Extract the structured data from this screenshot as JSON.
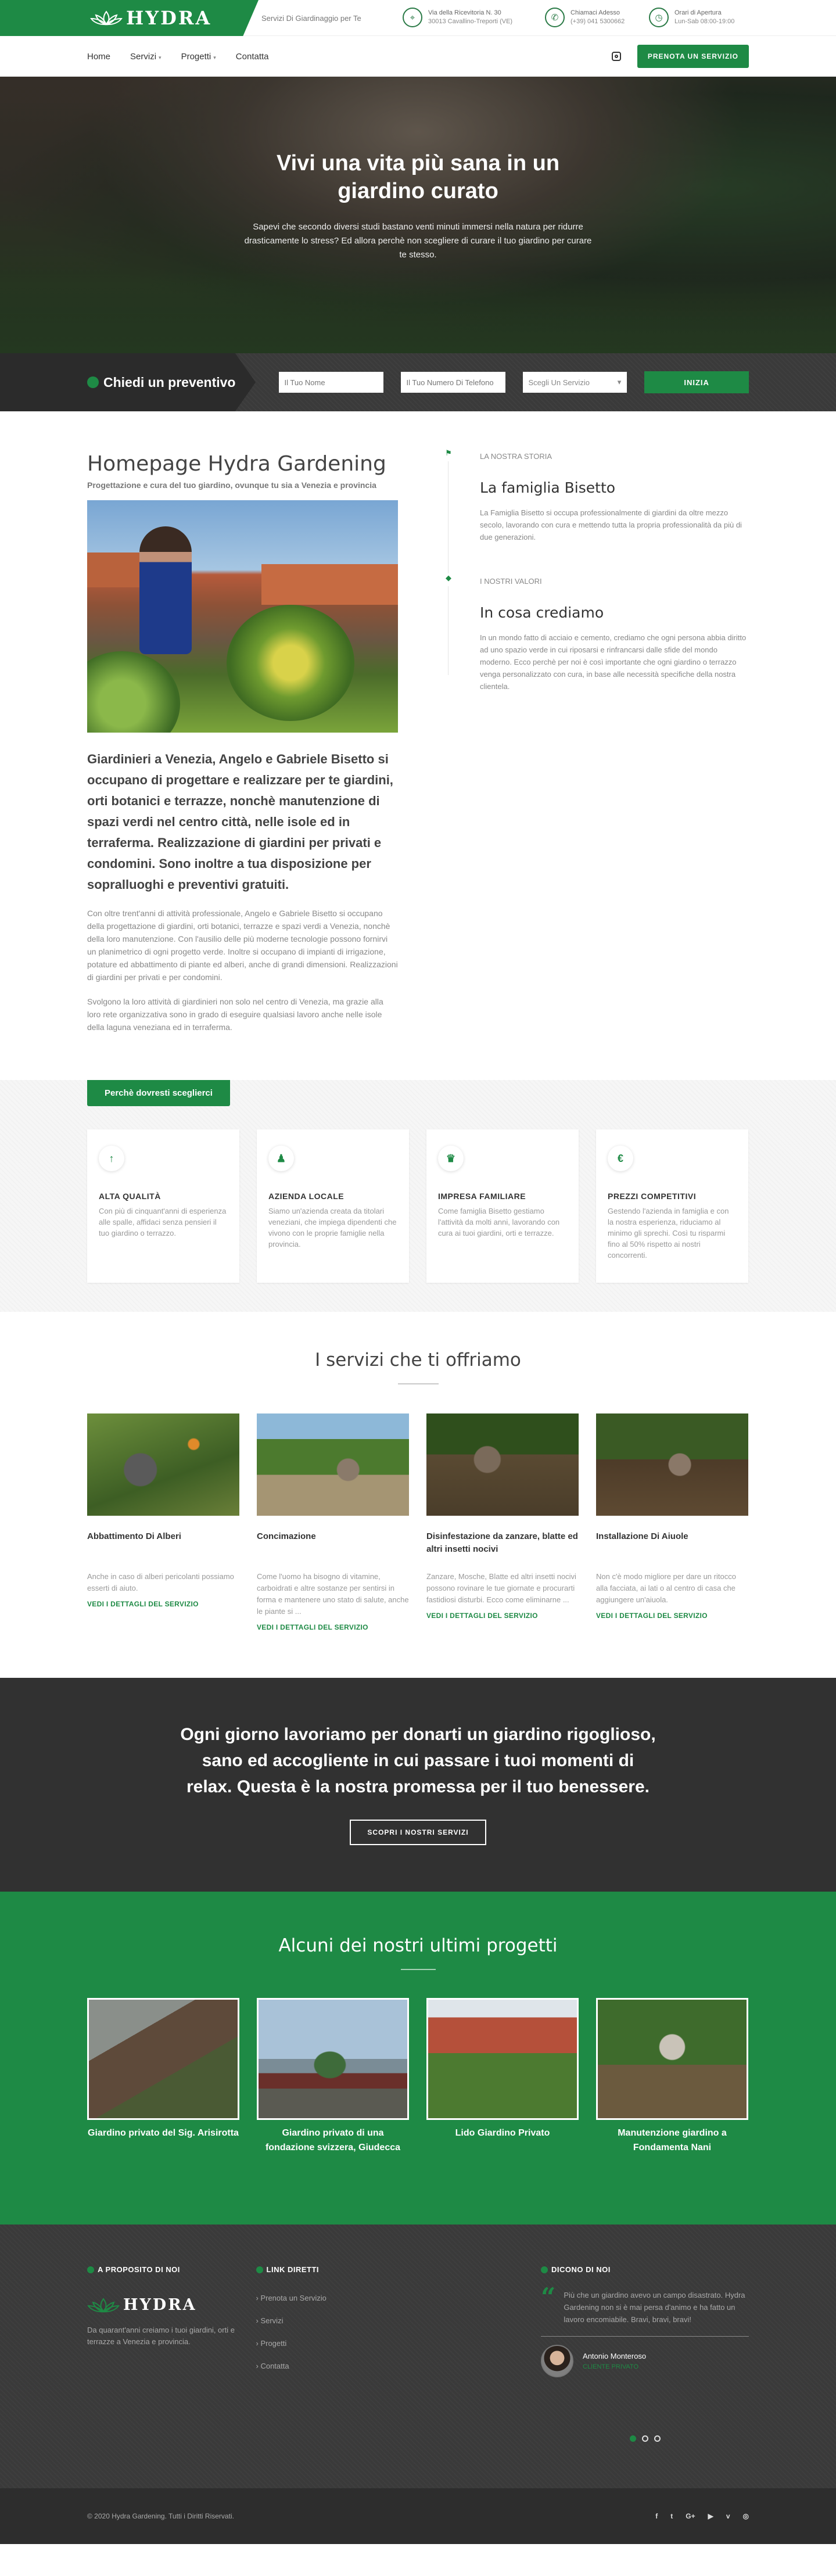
{
  "brand": {
    "name": "HYDRA",
    "tagline": "Servizi Di Giardinaggio per Te",
    "green": "#1e8a45",
    "dark": "#313131"
  },
  "contacts": [
    {
      "icon": "map-pin-icon",
      "title": "Via della Ricevitoria N. 30",
      "text": "30013 Cavallino-Treporti (VE)"
    },
    {
      "icon": "phone-icon",
      "title": "Chiamaci Adesso",
      "text": "(+39) 041 5300662"
    },
    {
      "icon": "clock-icon",
      "title": "Orari di Apertura",
      "text": "Lun-Sab 08:00-19:00"
    }
  ],
  "nav": {
    "items": [
      {
        "label": "Home",
        "caret": ""
      },
      {
        "label": "Servizi",
        "caret": "▾"
      },
      {
        "label": "Progetti",
        "caret": "▾"
      },
      {
        "label": "Contatta",
        "caret": ""
      }
    ],
    "cta": "PRENOTA UN SERVIZIO"
  },
  "hero": {
    "title": "Vivi una vita più sana in un giardino curato",
    "text": "Sapevi che secondo diversi studi bastano venti minuti immersi nella natura per ridurre drasticamente lo stress? Ed allora perchè non scegliere di curare il tuo giardino per curare te stesso."
  },
  "quote": {
    "title": "Chiedi un preventivo",
    "name_placeholder": "Il Tuo Nome",
    "phone_placeholder": "Il Tuo Numero Di Telefono",
    "select_value": "Scegli Un Servizio",
    "submit": "INIZIA"
  },
  "about": {
    "title": "Homepage Hydra Gardening",
    "subtitle": "Progettazione e cura del tuo giardino, ovunque tu sia a Venezia e provincia",
    "lead": "Giardinieri a Venezia, Angelo e Gabriele Bisetto si occupano di progettare e realizzare per te giardini, orti botanici e terrazze, nonchè manutenzione di spazi verdi nel centro città, nelle isole ed in terraferma. Realizzazione di giardini per privati e condomini. Sono inoltre a tua disposizione per sopralluoghi e preventivi gratuiti.",
    "p1": "Con oltre trent'anni di attività professionale, Angelo e Gabriele Bisetto si occupano della progettazione di giardini, orti botanici, terrazze e spazi verdi a Venezia, nonchè della loro manutenzione. Con l'ausilio delle più moderne tecnologie possono fornirvi un planimetrico di ogni progetto verde. Inoltre si occupano di impianti di irrigazione, potature ed abbattimento di piante ed alberi, anche di grandi dimensioni. Realizzazioni di giardini per privati e per condomini.",
    "p2": "Svolgono la loro attività di giardinieri non solo nel centro di Venezia, ma grazie alla loro rete organizzativa sono in grado di eseguire qualsiasi lavoro anche nelle isole della laguna veneziana ed in terraferma."
  },
  "timeline": [
    {
      "icon": "flag-icon",
      "label": "LA NOSTRA STORIA",
      "title": "La famiglia Bisetto",
      "text": "La Famiglia Bisetto si occupa professionalmente di giardini da oltre mezzo secolo, lavorando con cura e mettendo tutta la propria professionalità da più di due generazioni."
    },
    {
      "icon": "diamond-icon",
      "label": "I NOSTRI VALORI",
      "title": "In cosa crediamo",
      "text": "In un mondo fatto di acciaio e cemento, crediamo che ogni persona abbia diritto ad uno spazio verde in cui riposarsi e rinfrancarsi dalle sfide del mondo moderno. Ecco perchè per noi è così importante che ogni giardino o terrazzo venga personalizzato con cura, in base alle necessità specifiche della nostra clientela."
    }
  ],
  "why": {
    "tab": "Perchè dovresti sceglierci",
    "cards": [
      {
        "icon": "arrow-up-icon",
        "glyph": "↑",
        "title": "ALTA QUALITÀ",
        "text": "Con più di cinquant'anni di esperienza alle spalle, affidaci senza pensieri il tuo giardino o terrazzo."
      },
      {
        "icon": "users-icon",
        "glyph": "♟",
        "title": "AZIENDA LOCALE",
        "text": "Siamo un'azienda creata da titolari veneziani, che impiega dipendenti che vivono con le proprie famiglie nella provincia."
      },
      {
        "icon": "trophy-icon",
        "glyph": "♛",
        "title": "IMPRESA FAMILIARE",
        "text": "Come famiglia Bisetto gestiamo l'attività da molti anni, lavorando con cura ai tuoi giardini, orti e terrazze."
      },
      {
        "icon": "euro-icon",
        "glyph": "€",
        "title": "PREZZI COMPETITIVI",
        "text": "Gestendo l'azienda in famiglia e con la nostra esperienza, riduciamo al minimo gli sprechi. Così tu risparmi fino al 50% rispetto ai nostri concorrenti."
      }
    ]
  },
  "services": {
    "title": "I servizi che ti offriamo",
    "items": [
      {
        "title": "Abbattimento Di Alberi",
        "text": "Anche in caso di alberi pericolanti possiamo esserti di aiuto.",
        "link": "VEDI I DETTAGLI DEL SERVIZIO"
      },
      {
        "title": "Concimazione",
        "text": "Come l'uomo ha bisogno di vitamine, carboidrati e altre sostanze per sentirsi in forma e mantenere uno stato di salute, anche le piante si ...",
        "link": "VEDI I DETTAGLI DEL SERVIZIO"
      },
      {
        "title": "Disinfestazione da zanzare, blatte ed altri insetti nocivi",
        "text": "Zanzare, Mosche, Blatte ed altri insetti nocivi possono rovinare le tue giornate e procurarti fastidiosi disturbi. Ecco come eliminarne ...",
        "link": "VEDI I DETTAGLI DEL SERVIZIO"
      },
      {
        "title": "Installazione Di Aiuole",
        "text": "Non c'è modo migliore per dare un ritocco alla facciata, ai lati o al centro di casa che aggiungere un'aiuola.",
        "link": "VEDI I DETTAGLI DEL SERVIZIO"
      }
    ]
  },
  "banner": {
    "text": "Ogni giorno lavoriamo per donarti un giardino rigoglioso, sano ed accogliente in cui passare i tuoi momenti di relax. Questa è la nostra promessa per il tuo benessere.",
    "button": "SCOPRI I NOSTRI SERVIZI"
  },
  "projects": {
    "title": "Alcuni dei nostri ultimi progetti",
    "items": [
      {
        "title": "Giardino privato del Sig. Arisirotta"
      },
      {
        "title": "Giardino privato di una fondazione svizzera, Giudecca"
      },
      {
        "title": "Lido Giardino Privato"
      },
      {
        "title": "Manutenzione giardino a Fondamenta Nani"
      }
    ]
  },
  "footer": {
    "about_head": "A PROPOSITO DI NOI",
    "about_text": "Da quarant'anni creiamo i tuoi giardini, orti e terrazze a Venezia e provincia.",
    "links_head": "LINK DIRETTI",
    "links": [
      "› Prenota un Servizio",
      "› Servizi",
      "› Progetti",
      "› Contatta"
    ],
    "testi_head": "DICONO DI NOI",
    "testimonial": "Più che un giardino avevo un campo disastrato. Hydra Gardening non si è mai persa d'animo e ha fatto un lavoro encomiabile. Bravi, bravi, bravi!",
    "author": "Antonio Monteroso",
    "author_role": "CLIENTE PRIVATO",
    "copyright": "© 2020 Hydra Gardening. Tutti i Diritti Riservati.",
    "socials": [
      {
        "icon": "facebook-icon",
        "glyph": "f"
      },
      {
        "icon": "twitter-icon",
        "glyph": "t"
      },
      {
        "icon": "google-plus-icon",
        "glyph": "G+"
      },
      {
        "icon": "youtube-icon",
        "glyph": "▶"
      },
      {
        "icon": "vimeo-icon",
        "glyph": "v"
      },
      {
        "icon": "instagram-icon",
        "glyph": "◎"
      }
    ]
  }
}
